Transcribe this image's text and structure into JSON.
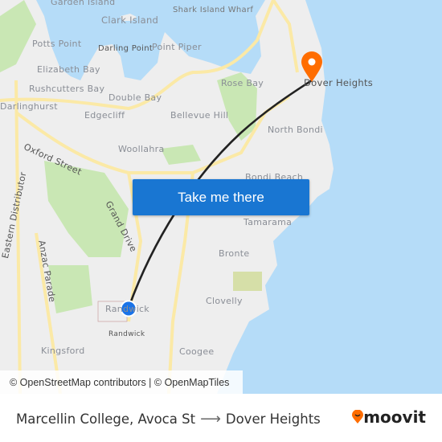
{
  "map": {
    "labels": [
      {
        "text": "Garden Island"
      },
      {
        "text": "Clark Island"
      },
      {
        "text": "Shark Island Wharf"
      },
      {
        "text": "Potts Point"
      },
      {
        "text": "Darling Point"
      },
      {
        "text": "Point Piper"
      },
      {
        "text": "Elizabeth Bay"
      },
      {
        "text": "Rushcutters Bay"
      },
      {
        "text": "Double Bay"
      },
      {
        "text": "Rose Bay"
      },
      {
        "text": "Darlinghurst"
      },
      {
        "text": "Edgecliff"
      },
      {
        "text": "Bellevue Hill"
      },
      {
        "text": "North Bondi"
      },
      {
        "text": "Oxford Street"
      },
      {
        "text": "Woollahra"
      },
      {
        "text": "Bondi Beach"
      },
      {
        "text": "Grand Drive"
      },
      {
        "text": "Eastern Distributor"
      },
      {
        "text": "Tamarama"
      },
      {
        "text": "Anzac Parade"
      },
      {
        "text": "Bronte"
      },
      {
        "text": "Randwick"
      },
      {
        "text": "Clovelly"
      },
      {
        "text": "Randwick"
      },
      {
        "text": "Kingsford"
      },
      {
        "text": "Coogee"
      },
      {
        "text": "Dover Heights"
      }
    ],
    "colors": {
      "land": "#eeeeee",
      "water": "#b5dcf8",
      "park": "#c9e7b4",
      "road": "#fbe9a6",
      "route": "#222222",
      "origin": "#1a73e8",
      "destination": "#ff6d00"
    },
    "origin_icon": "origin-dot-icon",
    "destination_icon": "destination-pin-icon"
  },
  "cta": {
    "label": "Take me there"
  },
  "attribution": "© OpenStreetMap contributors | © OpenMapTiles",
  "footer": {
    "origin": "Marcellin College, Avoca St",
    "arrow": "⟶",
    "destination": "Dover Heights",
    "logo": "moovit"
  }
}
